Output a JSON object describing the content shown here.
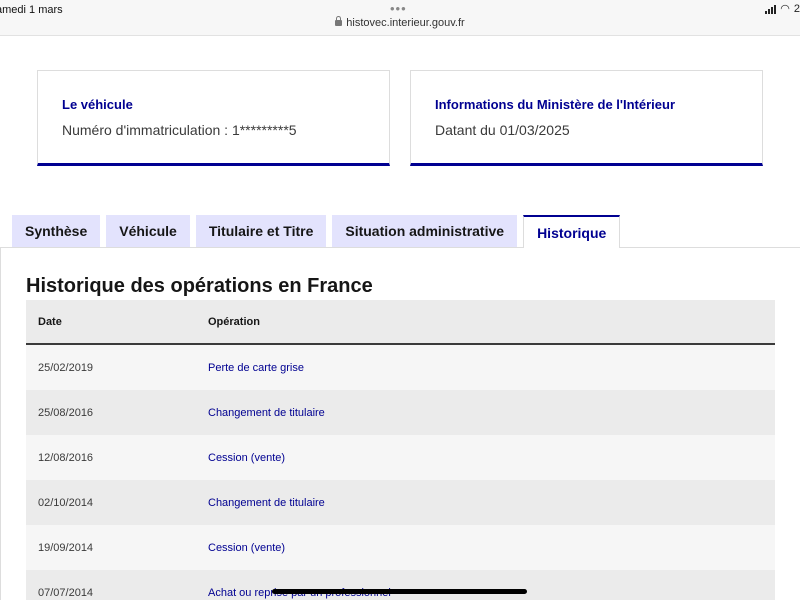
{
  "status_bar": {
    "date": "amedi 1 mars",
    "dots": "•••",
    "url": "histovec.interieur.gouv.fr",
    "battery": "2"
  },
  "vehicle_card": {
    "title": "Le véhicule",
    "registration": "Numéro d'immatriculation : 1*********5"
  },
  "ministry_card": {
    "title": "Informations du Ministère de l'Intérieur",
    "date": "Datant du 01/03/2025"
  },
  "tabs": [
    {
      "label": "Synthèse",
      "active": false
    },
    {
      "label": "Véhicule",
      "active": false
    },
    {
      "label": "Titulaire et Titre",
      "active": false
    },
    {
      "label": "Situation administrative",
      "active": false
    },
    {
      "label": "Historique",
      "active": true
    }
  ],
  "history": {
    "title": "Historique des opérations en France",
    "headers": {
      "date": "Date",
      "operation": "Opération"
    },
    "rows": [
      {
        "date": "25/02/2019",
        "operation": "Perte de carte grise"
      },
      {
        "date": "25/08/2016",
        "operation": "Changement de titulaire"
      },
      {
        "date": "12/08/2016",
        "operation": "Cession (vente)"
      },
      {
        "date": "02/10/2014",
        "operation": "Changement de titulaire"
      },
      {
        "date": "19/09/2014",
        "operation": "Cession (vente)"
      },
      {
        "date": "07/07/2014",
        "operation": "Achat ou reprise par un professionnel"
      }
    ]
  },
  "colors": {
    "accent": "#000091",
    "tab_background": "#e3e3fd",
    "row_odd": "#f6f6f6",
    "row_even": "#ebebeb"
  }
}
